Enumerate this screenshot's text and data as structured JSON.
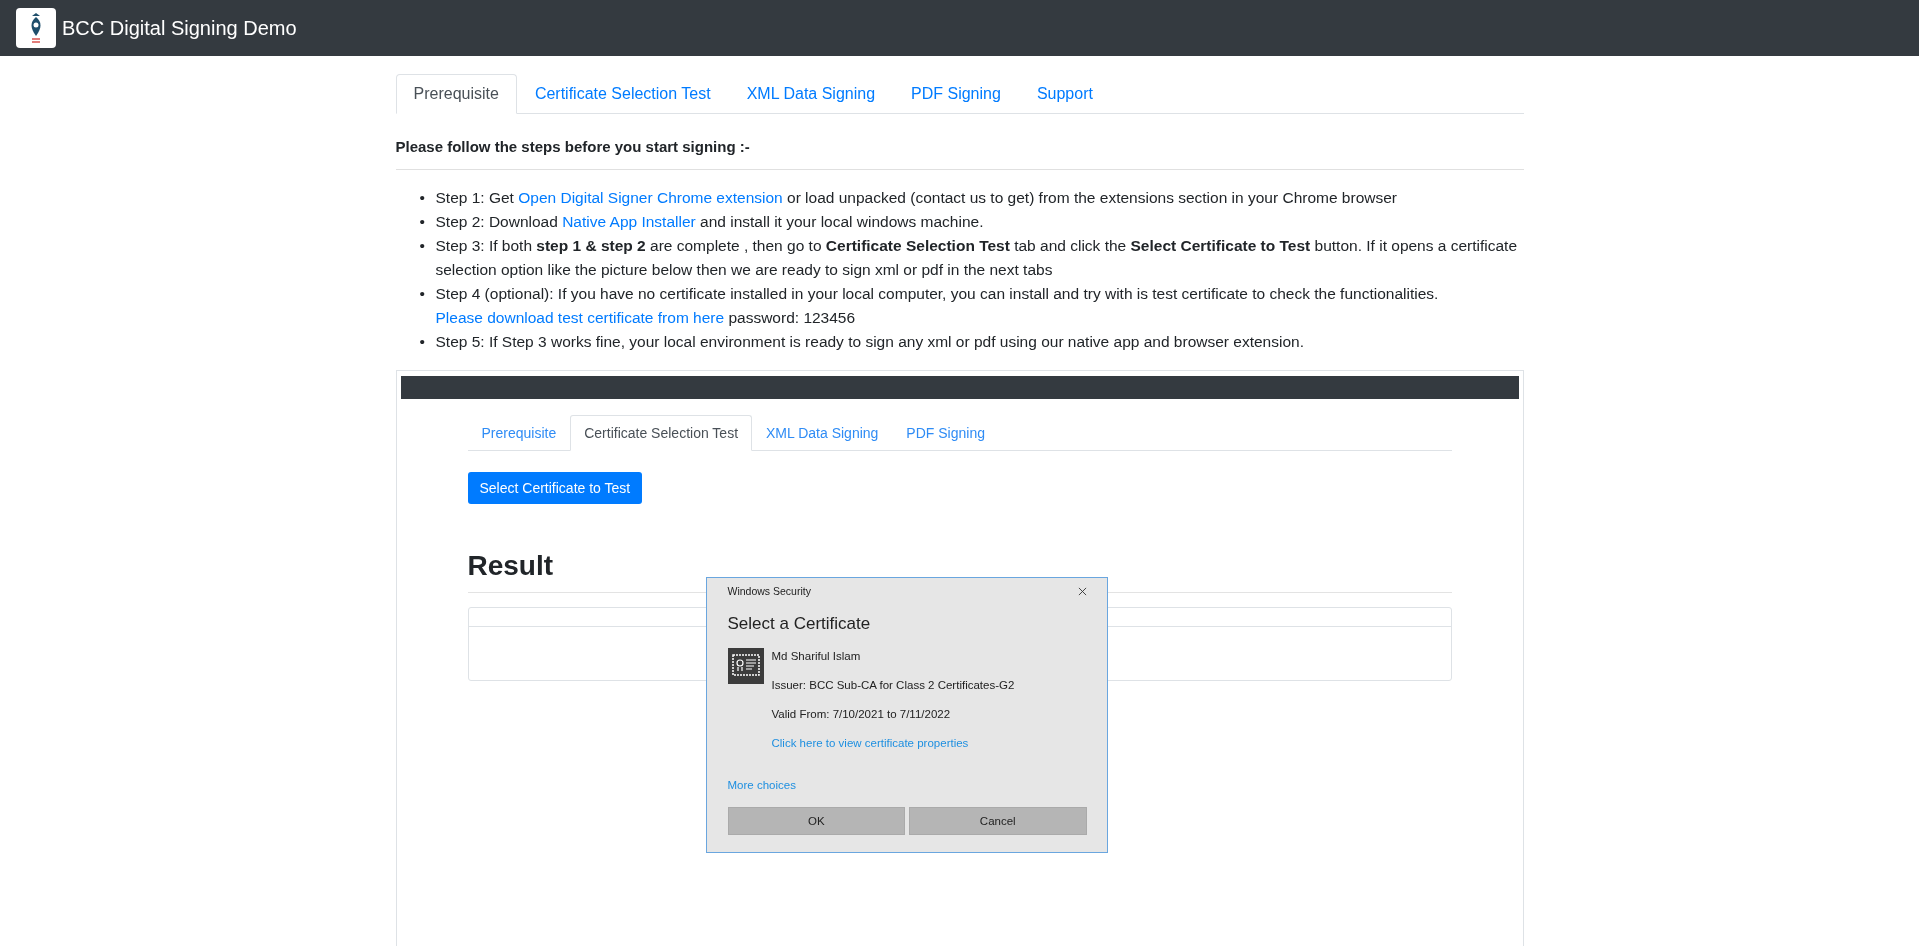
{
  "navbar": {
    "title": "BCC Digital Signing Demo"
  },
  "tabs": [
    {
      "label": "Prerequisite",
      "selected": true
    },
    {
      "label": "Certificate Selection Test",
      "selected": false
    },
    {
      "label": "XML Data Signing",
      "selected": false
    },
    {
      "label": "PDF Signing",
      "selected": false
    },
    {
      "label": "Support",
      "selected": false
    }
  ],
  "heading": "Please follow the steps before you start signing :-",
  "bullet": "•",
  "steps": [
    {
      "parts": [
        {
          "kind": "text",
          "text": "Step 1: Get "
        },
        {
          "kind": "link",
          "text": "Open Digital Signer Chrome extension"
        },
        {
          "kind": "text",
          "text": " or load unpacked (contact us to get) from the extensions section in your Chrome browser"
        }
      ]
    },
    {
      "parts": [
        {
          "kind": "text",
          "text": "Step 2: Download "
        },
        {
          "kind": "link",
          "text": "Native App Installer"
        },
        {
          "kind": "text",
          "text": " and install it your local windows machine."
        }
      ]
    },
    {
      "parts": [
        {
          "kind": "text",
          "text": "Step 3: If both **step 1 & step 2** are complete , then go to **Certificate Selection Test** tab and click the **Select Certificate to Test** button. If it opens a certificate selection option like the picture below then we are ready to sign xml or pdf in the next tabs"
        }
      ]
    },
    {
      "parts": [
        {
          "kind": "text",
          "text": "Step 4 (optional): If you have no certificate installed in your local computer, you can install and try with is test certificate to check the functionalities. "
        },
        {
          "kind": "link",
          "text": "Please download test certificate from here"
        },
        {
          "kind": "text",
          "text": " password: 123456"
        }
      ]
    },
    {
      "parts": [
        {
          "kind": "text",
          "text": "Step 5: If Step 3 works fine, your local environment is ready to sign any xml or pdf using our native app and browser extension."
        }
      ]
    }
  ],
  "preview": {
    "tabs": [
      {
        "label": "Prerequisite",
        "selected": false
      },
      {
        "label": "Certificate Selection Test",
        "selected": true
      },
      {
        "label": "XML Data Signing",
        "selected": false
      },
      {
        "label": "PDF Signing",
        "selected": false
      }
    ],
    "button": "Select Certificate to Test",
    "result_title": "Result",
    "dialog": {
      "caption": "Windows Security",
      "title": "Select a Certificate",
      "certificate": {
        "name": "Md Shariful Islam",
        "issuer": "Issuer: BCC Sub-CA for Class 2 Certificates-G2",
        "valid": "Valid From: 7/10/2021 to 7/11/2022",
        "properties_link": "Click here to view certificate properties"
      },
      "more_choices": "More choices",
      "buttons": [
        "OK",
        "Cancel"
      ]
    }
  }
}
